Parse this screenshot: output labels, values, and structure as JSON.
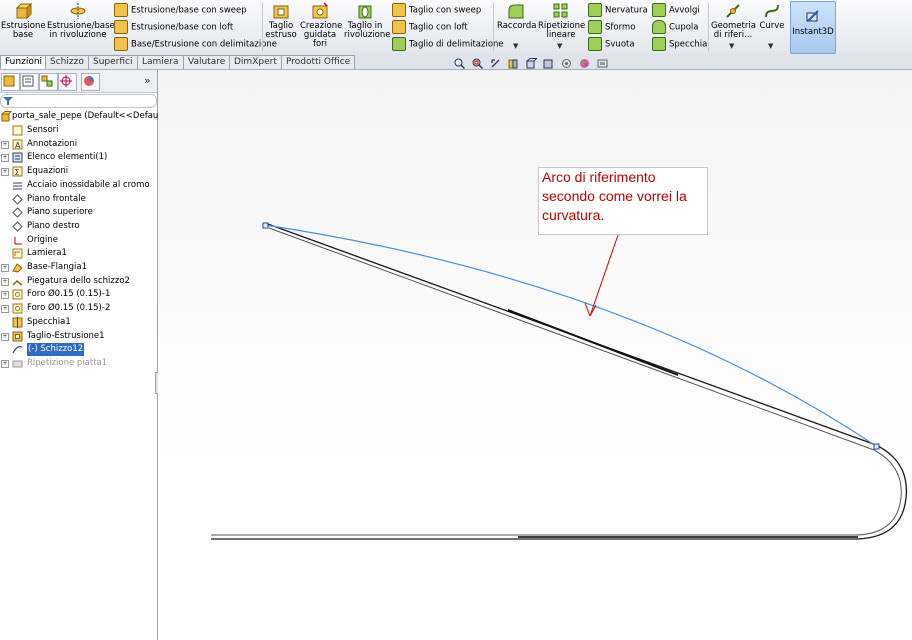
{
  "ribbon": {
    "big_buttons_1": [
      {
        "label": "Estrusione\nbase",
        "icon": "extrude-boss-icon"
      },
      {
        "label": "Estrusione/base\nin rivoluzione",
        "icon": "revolve-boss-icon"
      }
    ],
    "small_items_1": [
      {
        "label": "Estrusione/base con sweep",
        "icon": "sweep-boss-icon"
      },
      {
        "label": "Estrusione/base con loft",
        "icon": "loft-boss-icon"
      },
      {
        "label": "Base/Estrusione con delimitazione",
        "icon": "boundary-boss-icon"
      }
    ],
    "big_buttons_2": [
      {
        "label": "Taglio\nestruso",
        "icon": "extruded-cut-icon"
      },
      {
        "label": "Creazione\nguidata\nfori",
        "icon": "hole-wizard-icon"
      },
      {
        "label": "Taglio in\nrivoluzione",
        "icon": "revolved-cut-icon"
      }
    ],
    "small_items_2": [
      {
        "label": "Taglio con sweep",
        "icon": "swept-cut-icon"
      },
      {
        "label": "Taglio con loft",
        "icon": "lofted-cut-icon"
      },
      {
        "label": "Taglio di delimitazione",
        "icon": "boundary-cut-icon"
      }
    ],
    "big_buttons_3": [
      {
        "label": "Raccorda",
        "icon": "fillet-icon"
      },
      {
        "label": "Ripetizione\nlineare",
        "icon": "linear-pattern-icon"
      }
    ],
    "small_items_3": [
      {
        "label": "Nervatura",
        "icon": "rib-icon"
      },
      {
        "label": "Sformo",
        "icon": "draft-icon"
      },
      {
        "label": "Svuota",
        "icon": "shell-icon"
      }
    ],
    "small_items_4": [
      {
        "label": "Avvolgi",
        "icon": "wrap-icon"
      },
      {
        "label": "Cupola",
        "icon": "dome-icon"
      },
      {
        "label": "Specchia",
        "icon": "mirror-icon"
      }
    ],
    "big_buttons_4": [
      {
        "label": "Geometria\ndi riferi...",
        "icon": "reference-geometry-icon"
      },
      {
        "label": "Curve",
        "icon": "curves-icon"
      }
    ],
    "instant3d": {
      "label": "Instant3D",
      "icon": "instant3d-icon"
    }
  },
  "command_tabs": [
    "Funzioni",
    "Schizzo",
    "Superfici",
    "Lamiera",
    "Valutare",
    "DimXpert",
    "Prodotti Office"
  ],
  "active_tab": "Funzioni",
  "panel": {
    "expand_label": "»",
    "root": "porta_sale_pepe  (Default<<Default>_",
    "items": [
      {
        "label": "Sensori",
        "icon": "sensors-icon",
        "expandable": false
      },
      {
        "label": "Annotazioni",
        "icon": "annotations-icon",
        "expandable": true
      },
      {
        "label": "Elenco elementi(1)",
        "icon": "cut-list-icon",
        "expandable": true
      },
      {
        "label": "Equazioni",
        "icon": "equations-icon",
        "expandable": true
      },
      {
        "label": "Acciaio inossidabile al cromo",
        "icon": "material-icon",
        "expandable": false
      },
      {
        "label": "Piano frontale",
        "icon": "plane-icon",
        "expandable": false
      },
      {
        "label": "Piano superiore",
        "icon": "plane-icon",
        "expandable": false
      },
      {
        "label": "Piano destro",
        "icon": "plane-icon",
        "expandable": false
      },
      {
        "label": "Origine",
        "icon": "origin-icon",
        "expandable": false
      },
      {
        "label": "Lamiera1",
        "icon": "sheet-metal-icon",
        "expandable": false
      },
      {
        "label": "Base-Flangia1",
        "icon": "base-flange-icon",
        "expandable": true
      },
      {
        "label": "Piegatura dello schizzo2",
        "icon": "sketched-bend-icon",
        "expandable": true
      },
      {
        "label": "Foro Ø0.15 (0.15)-1",
        "icon": "hole-icon",
        "expandable": true
      },
      {
        "label": "Foro Ø0.15 (0.15)-2",
        "icon": "hole-icon",
        "expandable": true
      },
      {
        "label": "Specchia1",
        "icon": "mirror-feature-icon",
        "expandable": false
      },
      {
        "label": "Taglio-Estrusione1",
        "icon": "cut-extrude-icon",
        "expandable": true
      },
      {
        "label": "(-) Schizzo12",
        "icon": "sketch-icon",
        "expandable": false,
        "selected": true
      },
      {
        "label": "Ripetizione piatta1",
        "icon": "flat-pattern-icon",
        "expandable": true,
        "greyed": true
      }
    ]
  },
  "annotation": {
    "text_line1": "Arco di riferimento",
    "text_line2": "secondo come vorrei la",
    "text_line3": "curvatura.",
    "color": "#c00000"
  },
  "colors": {
    "reference_arc": "#4a8fe0",
    "part_edge": "#1a1a1a",
    "annotation_arrow": "#d00000",
    "selection": "#316ac5"
  }
}
